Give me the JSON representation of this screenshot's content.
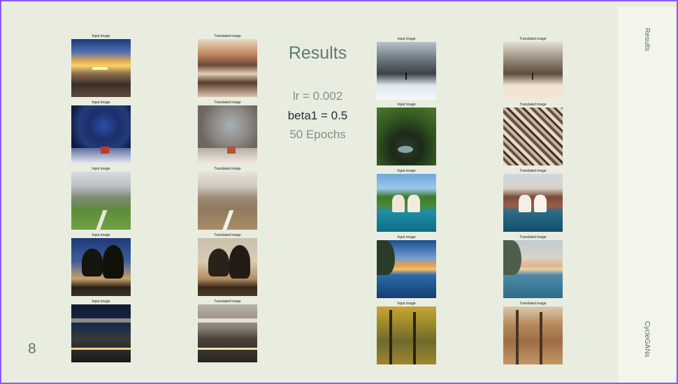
{
  "slide": {
    "title": "Results",
    "params": [
      "lr = 0.002",
      "beta1 = 0.5",
      "50 Epochs"
    ],
    "page_number": "8",
    "sidebar_top": "Results",
    "sidebar_bottom": "CycleGANs"
  },
  "captions": {
    "input": "Input image",
    "translated": "Translated image"
  },
  "left_pairs": [
    {
      "input": "sunset-rocky-shore",
      "translated": "sunset-rocky-shore-translated"
    },
    {
      "input": "star-trails-night",
      "translated": "star-trails-night-translated"
    },
    {
      "input": "mountain-valley-path",
      "translated": "mountain-valley-path-translated"
    },
    {
      "input": "trees-silhouette-dusk",
      "translated": "trees-silhouette-dusk-translated"
    },
    {
      "input": "bridge-night-lights",
      "translated": "bridge-night-lights-translated"
    }
  ],
  "right_pairs": [
    {
      "input": "fjord-misty-mountains",
      "translated": "fjord-misty-mountains-translated"
    },
    {
      "input": "jungle-stream",
      "translated": "jungle-stream-translated"
    },
    {
      "input": "tropical-rocks-sea",
      "translated": "tropical-rocks-sea-translated"
    },
    {
      "input": "sunset-lake-branches",
      "translated": "sunset-lake-branches-translated"
    },
    {
      "input": "autumn-forest",
      "translated": "autumn-forest-translated"
    }
  ]
}
